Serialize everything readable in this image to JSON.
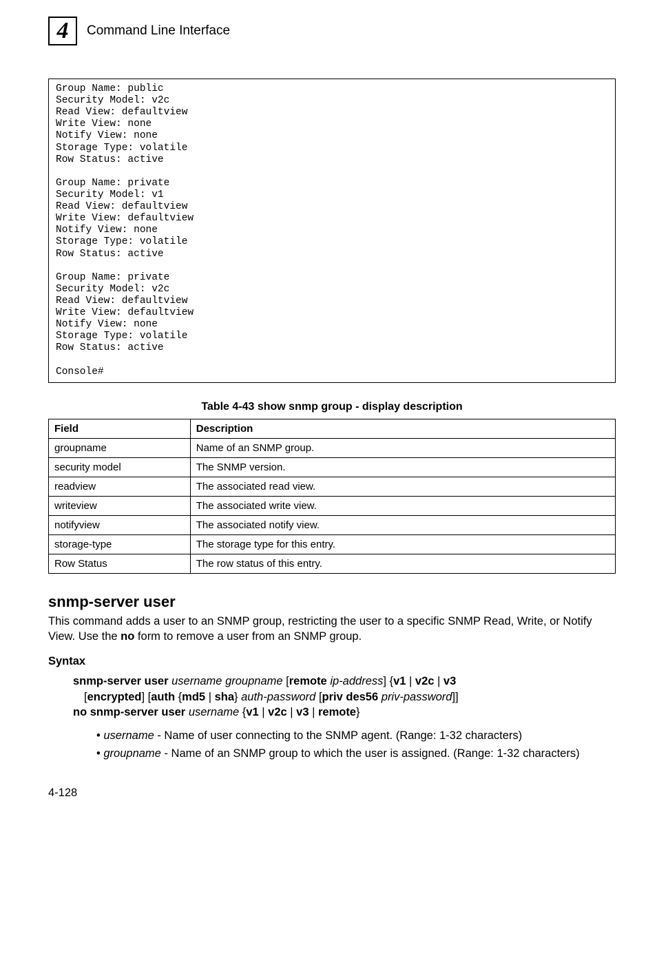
{
  "header": {
    "chapter_number": "4",
    "title": "Command Line Interface"
  },
  "code_block": "Group Name: public\nSecurity Model: v2c\nRead View: defaultview\nWrite View: none\nNotify View: none\nStorage Type: volatile\nRow Status: active\n\nGroup Name: private\nSecurity Model: v1\nRead View: defaultview\nWrite View: defaultview\nNotify View: none\nStorage Type: volatile\nRow Status: active\n\nGroup Name: private\nSecurity Model: v2c\nRead View: defaultview\nWrite View: defaultview\nNotify View: none\nStorage Type: volatile\nRow Status: active\n\nConsole#",
  "table": {
    "caption": "Table 4-43  show snmp group - display description",
    "headers": {
      "field": "Field",
      "description": "Description"
    },
    "rows": [
      {
        "field": "groupname",
        "description": "Name of an SNMP group."
      },
      {
        "field": "security model",
        "description": "The SNMP version."
      },
      {
        "field": "readview",
        "description": "The associated read view."
      },
      {
        "field": "writeview",
        "description": "The associated write view."
      },
      {
        "field": "notifyview",
        "description": "The associated notify view."
      },
      {
        "field": "storage-type",
        "description": "The storage type for this entry."
      },
      {
        "field": "Row Status",
        "description": "The row status of this entry."
      }
    ]
  },
  "command": {
    "heading": "snmp-server user",
    "desc_pre": "This command adds a user to an SNMP group, restricting the user to a specific SNMP Read, Write, or Notify View. Use the ",
    "desc_bold": "no",
    "desc_post": " form to remove a user from an SNMP group.",
    "syntax_heading": "Syntax",
    "syntax": {
      "tokens": {
        "snmp_server_user": "snmp-server user",
        "username": "username",
        "groupname": "groupname",
        "remote": "remote",
        "ip_address": "ip-address",
        "v1": "v1",
        "v2c": "v2c",
        "v3": "v3",
        "encrypted": "encrypted",
        "auth": "auth",
        "md5": "md5",
        "sha": "sha",
        "auth_password": "auth-password",
        "priv_des56": "priv des56",
        "priv_password": "priv-password",
        "no_snmp_server_user": "no snmp-server user"
      }
    },
    "params": [
      {
        "name": "username",
        "desc": " - Name of user connecting to the SNMP agent. (Range: 1-32 characters)"
      },
      {
        "name": "groupname",
        "desc": " - Name of an SNMP group to which the user is assigned. (Range: 1-32 characters)"
      }
    ]
  },
  "page_number": "4-128"
}
